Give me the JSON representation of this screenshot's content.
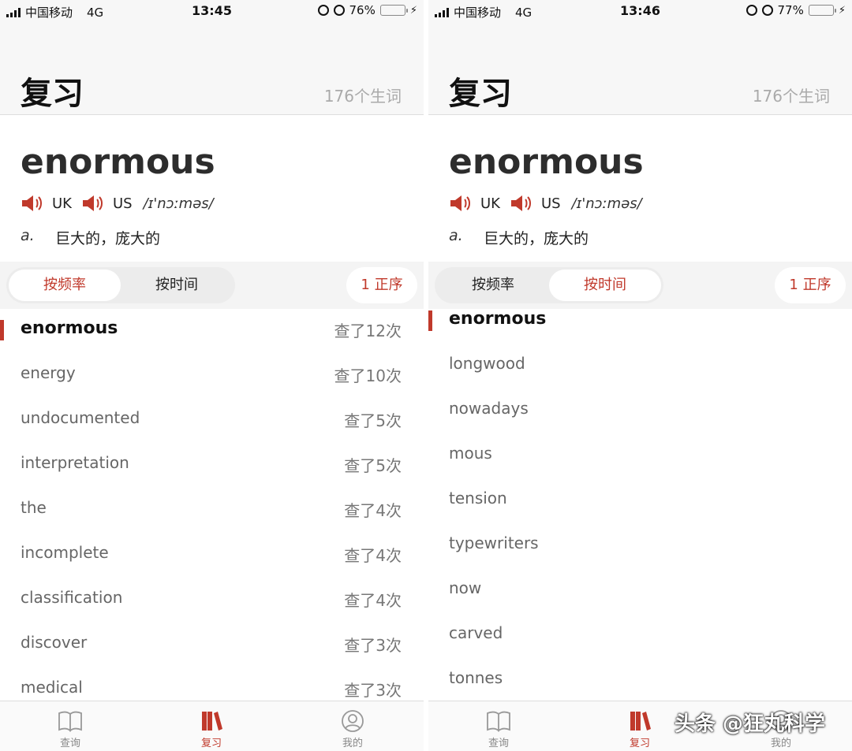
{
  "colors": {
    "accent": "#c0392b",
    "battery": "#3bc44b"
  },
  "screens": [
    {
      "status": {
        "carrier": "中国移动",
        "network": "4G",
        "time": "13:45",
        "battery": "76%",
        "battery_level": 0.76
      },
      "header": {
        "title": "复习",
        "count": "176个生词"
      },
      "card": {
        "word": "enormous",
        "uk": "UK",
        "us": "US",
        "ipa": "/ɪ'nɔːməs/",
        "pos": "a.",
        "definition": "巨大的，庞大的"
      },
      "sort": {
        "by_frequency": "按频率",
        "by_time": "按时间",
        "order": "1 正序",
        "active": "by_frequency"
      },
      "list": [
        {
          "word": "enormous",
          "count": "查了12次"
        },
        {
          "word": "energy",
          "count": "查了10次"
        },
        {
          "word": "undocumented",
          "count": "查了5次"
        },
        {
          "word": "interpretation",
          "count": "查了5次"
        },
        {
          "word": "the",
          "count": "查了4次"
        },
        {
          "word": "incomplete",
          "count": "查了4次"
        },
        {
          "word": "classification",
          "count": "查了4次"
        },
        {
          "word": "discover",
          "count": "查了3次"
        },
        {
          "word": "medical",
          "count": "查了3次"
        }
      ],
      "nav": {
        "lookup": "查询",
        "review": "复习",
        "mine": "我的"
      }
    },
    {
      "status": {
        "carrier": "中国移动",
        "network": "4G",
        "time": "13:46",
        "battery": "77%",
        "battery_level": 0.77
      },
      "header": {
        "title": "复习",
        "count": "176个生词"
      },
      "card": {
        "word": "enormous",
        "uk": "UK",
        "us": "US",
        "ipa": "/ɪ'nɔːməs/",
        "pos": "a.",
        "definition": "巨大的，庞大的"
      },
      "sort": {
        "by_frequency": "按频率",
        "by_time": "按时间",
        "order": "1 正序",
        "active": "by_time"
      },
      "list": [
        {
          "word": "enormous",
          "count": ""
        },
        {
          "word": "longwood",
          "count": ""
        },
        {
          "word": "nowadays",
          "count": ""
        },
        {
          "word": "mous",
          "count": ""
        },
        {
          "word": "tension",
          "count": ""
        },
        {
          "word": "typewriters",
          "count": ""
        },
        {
          "word": "now",
          "count": ""
        },
        {
          "word": "carved",
          "count": ""
        },
        {
          "word": "tonnes",
          "count": ""
        }
      ],
      "nav": {
        "lookup": "查询",
        "review": "复习",
        "mine": "我的"
      }
    }
  ],
  "watermark": "头条 @狂丸科学"
}
